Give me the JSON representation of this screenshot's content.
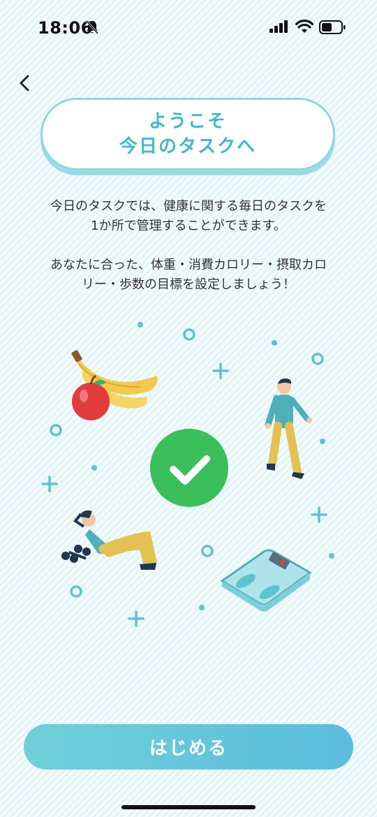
{
  "status_bar": {
    "time": "18:06"
  },
  "welcome": {
    "line1": "ようこそ",
    "line2": "今日のタスクへ"
  },
  "description": {
    "para1_line1": "今日のタスクでは、健康に関する毎日のタスクを",
    "para1_line2": "1か所で管理することができます。",
    "para2_line1": "あなたに合った、体重・消費カロリー・摂取カロ",
    "para2_line2": "リー・歩数の目標を設定しましょう！"
  },
  "illustration": {
    "icons": [
      "fruit-icon",
      "walking-person-icon",
      "checkmark-icon",
      "exercise-woman-icon",
      "dumbbell-icon",
      "scale-icon"
    ]
  },
  "start_button": {
    "label": "はじめる"
  },
  "colors": {
    "accent": "#3fb9cf",
    "button": "#5fc6db",
    "check": "#3bbf5a"
  }
}
